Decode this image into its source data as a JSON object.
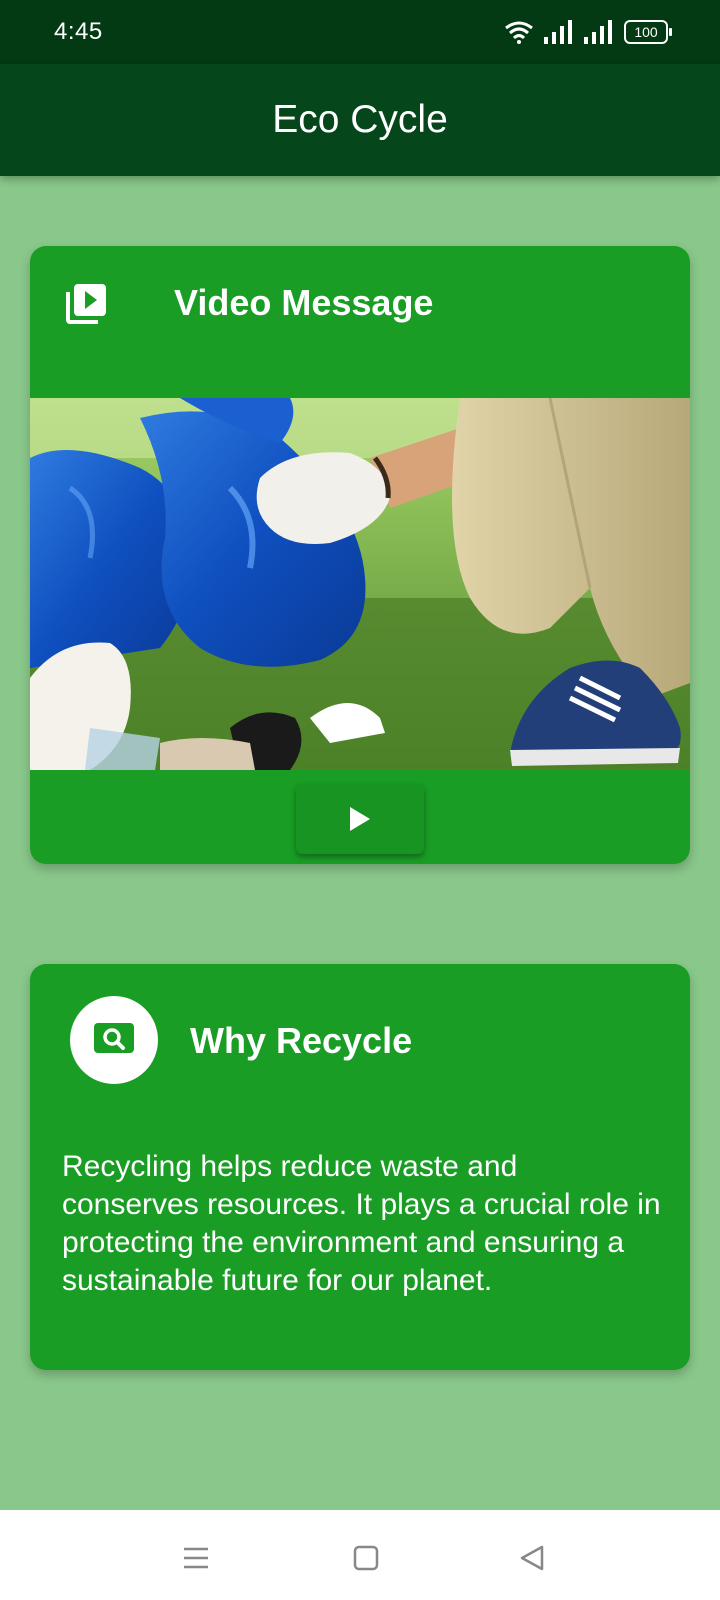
{
  "status_bar": {
    "time": "4:45",
    "battery": "100"
  },
  "app_bar": {
    "title": "Eco Cycle"
  },
  "video_card": {
    "icon": "video-library-icon",
    "title": "Video Message",
    "thumbnail": "person-collecting-trash-into-blue-bags",
    "play_icon": "play-icon"
  },
  "why_card": {
    "icon": "search-icon",
    "title": "Why Recycle",
    "body": "Recycling helps reduce waste and conserves resources. It plays a crucial role in protecting the environment and ensuring a sustainable future for our planet."
  },
  "nav_bar": {
    "menu_icon": "menu-icon",
    "home_icon": "home-square-icon",
    "back_icon": "back-triangle-icon"
  },
  "colors": {
    "background": "#89c78a",
    "app_bar": "#05461a",
    "status_bar": "#033a14",
    "card": "#199d25"
  }
}
